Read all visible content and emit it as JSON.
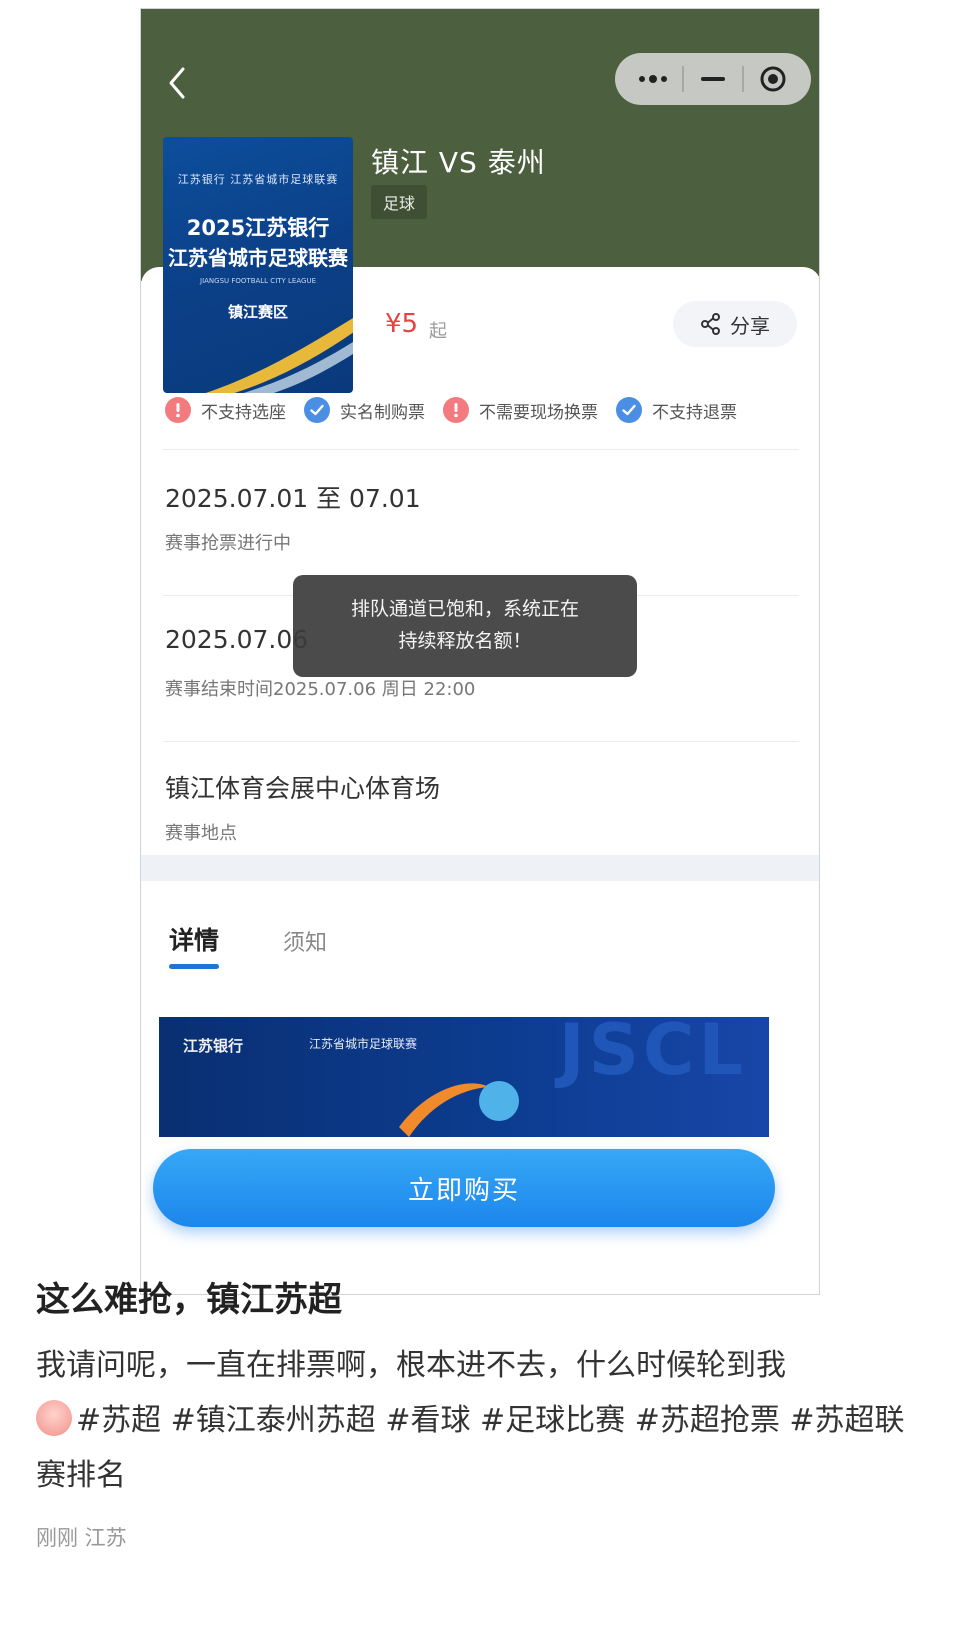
{
  "app": {
    "event_title": "镇江 VS 泰州",
    "sport_tag": "足球",
    "poster": {
      "logos": "江苏银行  江苏省城市足球联赛",
      "line1": "2025江苏银行",
      "line2": "江苏省城市足球联赛",
      "line3": "JIANGSU FOOTBALL CITY LEAGUE",
      "line4": "镇江赛区"
    },
    "price": "¥5",
    "price_suffix": "起",
    "share_label": "分享",
    "features": [
      {
        "label": "不支持选座",
        "type": "warn"
      },
      {
        "label": "实名制购票",
        "type": "check"
      },
      {
        "label": "不需要现场换票",
        "type": "warn"
      },
      {
        "label": "不支持退票",
        "type": "check"
      }
    ],
    "sale_period": {
      "main": "2025.07.01 至 07.01",
      "sub": "赛事抢票进行中"
    },
    "event_time": {
      "main": "2025.07.06",
      "sub": "赛事结束时间2025.07.06 周日 22:00"
    },
    "venue": {
      "main": "镇江体育会展中心体育场",
      "sub": "赛事地点"
    },
    "tabs": [
      {
        "label": "详情"
      },
      {
        "label": "须知"
      }
    ],
    "banner": {
      "left": "江苏银行",
      "mid": "江苏省城市足球联赛",
      "big": "JSCL"
    },
    "buy_label": "立即购买",
    "toast": {
      "line1": "排队通道已饱和，系统正在",
      "line2": "持续释放名额！"
    },
    "colors": {
      "header": "#4c5f3e",
      "price": "#e8423f",
      "buy_button": "#2196f3",
      "tab_underline": "#1f74d6"
    }
  },
  "post": {
    "title": "这么难抢，镇江苏超",
    "body_text": "我请问呢，一直在排票啊，根本进不去，什么时候轮到我",
    "hashtags": "#苏超 #镇江泰州苏超 #看球 #足球比赛 #苏超抢票 #苏超联赛排名",
    "meta": "刚刚 江苏"
  }
}
